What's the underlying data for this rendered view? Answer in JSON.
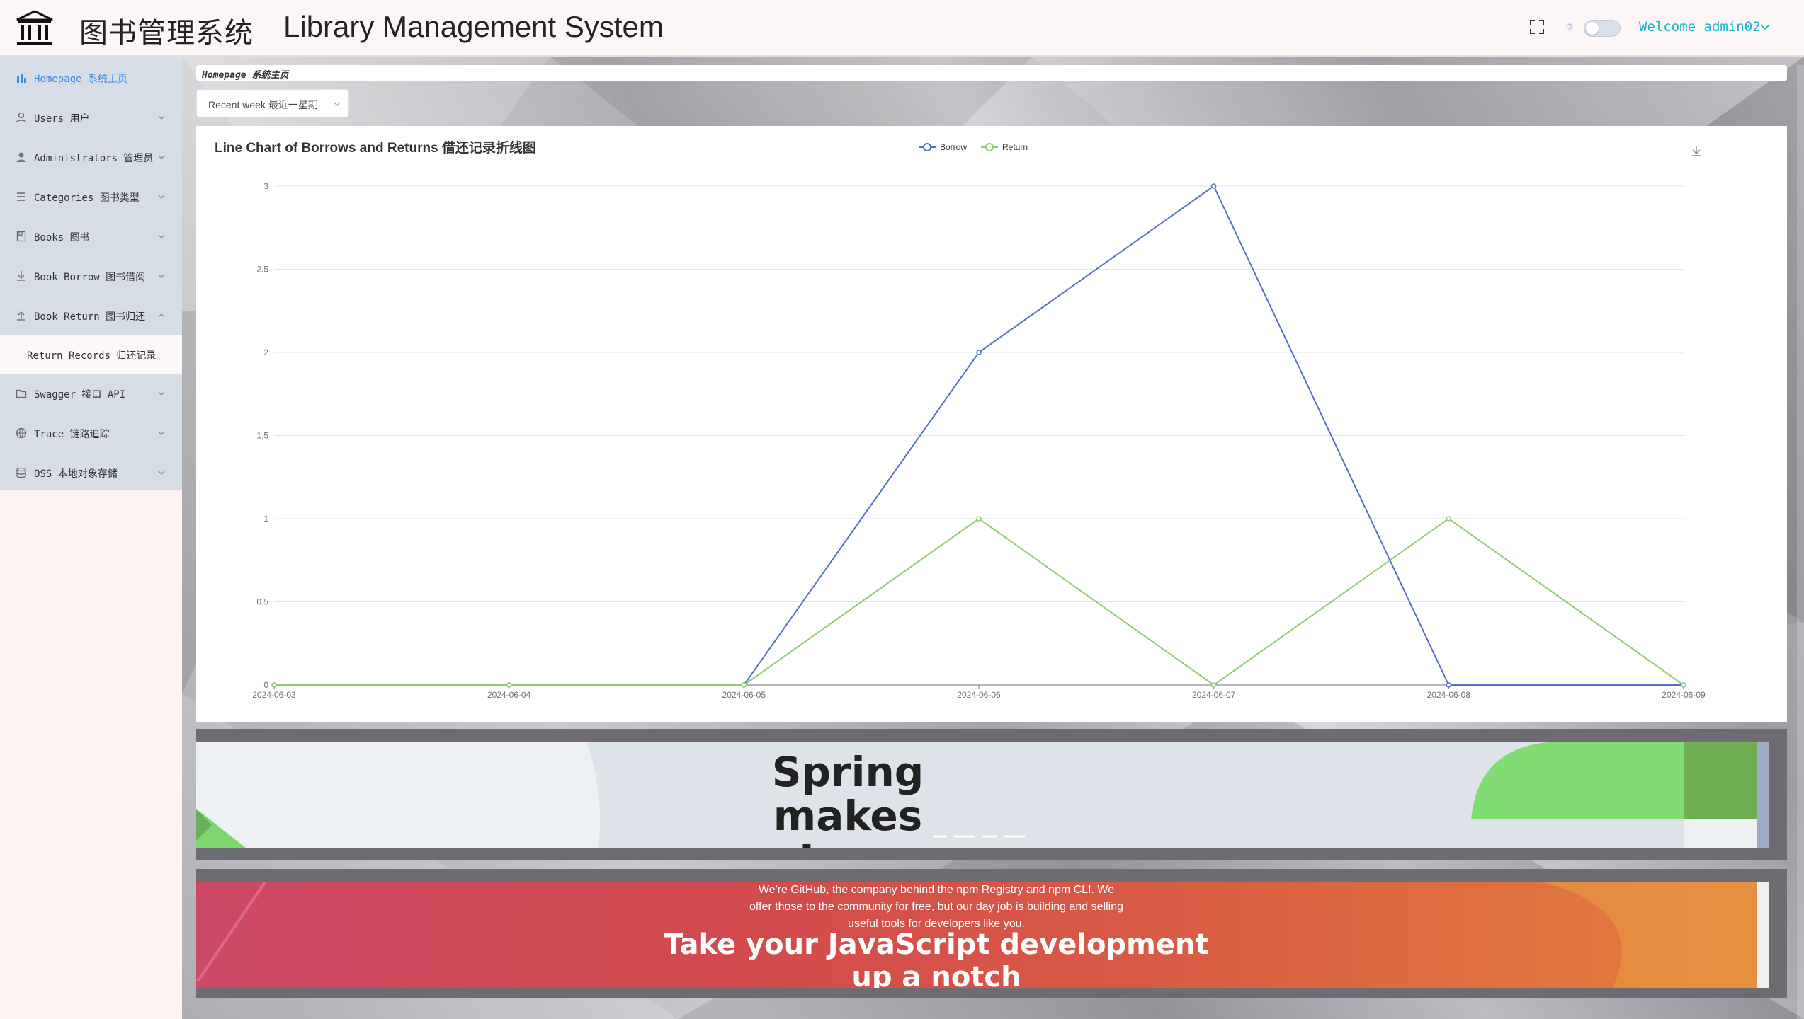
{
  "header": {
    "title_cn": "图书管理系统",
    "title_en": "Library Management System",
    "welcome": "Welcome admin02"
  },
  "sidebar": {
    "items": [
      {
        "label": "Homepage 系统主页",
        "icon": "bar-chart-icon",
        "active": true
      },
      {
        "label": "Users 用户",
        "icon": "user-icon"
      },
      {
        "label": "Administrators 管理员",
        "icon": "admin-icon"
      },
      {
        "label": "Categories 图书类型",
        "icon": "list-icon"
      },
      {
        "label": "Books 图书",
        "icon": "book-icon"
      },
      {
        "label": "Book Borrow 图书借阅",
        "icon": "download-icon"
      },
      {
        "label": "Book Return 图书归还",
        "icon": "upload-icon",
        "expanded": true
      },
      {
        "label": "Swagger 接口 API",
        "icon": "folder-icon"
      },
      {
        "label": "Trace 链路追踪",
        "icon": "globe-icon"
      },
      {
        "label": "OSS 本地对象存储",
        "icon": "database-icon"
      }
    ],
    "sub_items": [
      {
        "label": "Return Records 归还记录"
      }
    ]
  },
  "breadcrumb": "Homepage 系统主页",
  "range_select": {
    "value": "Recent week 最近一星期"
  },
  "chart_data": {
    "type": "line",
    "title": "Line Chart of Borrows and Returns 借还记录折线图",
    "x": [
      "2024-06-03",
      "2024-06-04",
      "2024-06-05",
      "2024-06-06",
      "2024-06-07",
      "2024-06-08",
      "2024-06-09"
    ],
    "series": [
      {
        "name": "Borrow",
        "values": [
          0,
          0,
          0,
          2,
          3,
          0,
          0
        ],
        "color": "#5470c6"
      },
      {
        "name": "Return",
        "values": [
          0,
          0,
          0,
          1,
          0,
          1,
          0
        ],
        "color": "#91cc75"
      }
    ],
    "yticks": [
      "0",
      "0.5",
      "1",
      "1.5",
      "2",
      "2.5",
      "3"
    ],
    "ylim": [
      0,
      3
    ],
    "grid": true,
    "legend": "top-center"
  },
  "banner1": {
    "title": "Spring makes Java simple."
  },
  "banner2": {
    "text": "We're GitHub, the company behind the npm Registry and npm CLI. We offer those to the community for free, but our day job is building and selling useful tools for developers like you.",
    "title": "Take your JavaScript development up a notch"
  }
}
